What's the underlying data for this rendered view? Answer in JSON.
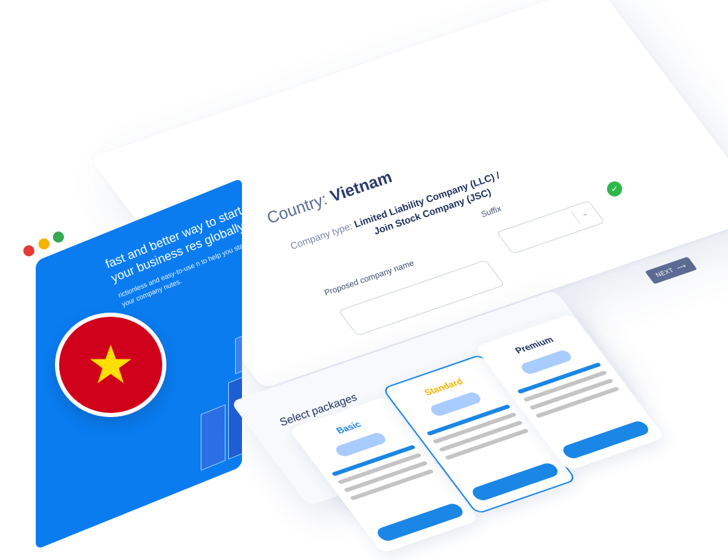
{
  "window_controls": [
    "close",
    "minimize",
    "maximize"
  ],
  "hero": {
    "title": "fast and better way to start your business res globally",
    "subtitle": "rictionless and easy-to-use n to help you start your company nutes."
  },
  "flag": {
    "country": "Vietnam",
    "icon": "vietnam-flag-icon"
  },
  "form": {
    "country_prefix": "Country:",
    "country_value": "Vietnam",
    "company_type_prefix": "Company type:",
    "company_type_line1": "Limited Liability Company (LLC) /",
    "company_type_line2": "Join Stock Company (JSC)",
    "suffix_label": "Suffix",
    "suffix_value": "",
    "proposed_name_label": "Proposed company name",
    "proposed_name_value": "",
    "next_label": "NEXT",
    "next_icon": "arrow-right-icon"
  },
  "packages": {
    "title": "Select packages",
    "items": [
      {
        "name": "Basic",
        "color": "#1a86e6",
        "selected": false
      },
      {
        "name": "Standard",
        "color": "#f5b400",
        "selected": true
      },
      {
        "name": "Premium",
        "color": "#1f2d5c",
        "selected": false
      }
    ]
  },
  "colors": {
    "primary_blue": "#0a7cf0",
    "accent_blue": "#1a86e6",
    "success_green": "#2db84d",
    "dark_navy": "#1f2d5c",
    "flag_red": "#d0021b",
    "flag_star": "#ffde00"
  }
}
